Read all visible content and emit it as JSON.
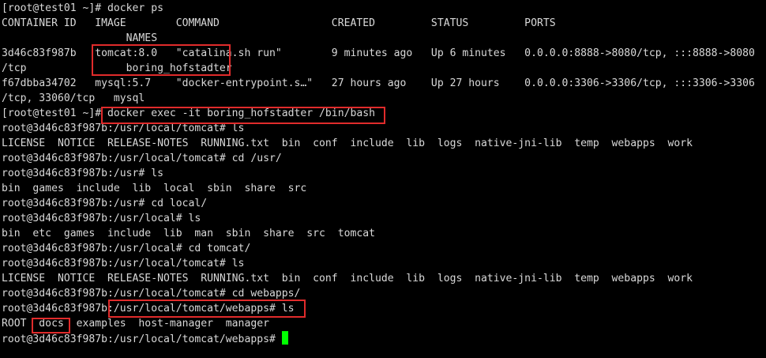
{
  "terminal": {
    "lines": [
      "CONTAINER ID   IMAGE        COMMAND                  CREATED         STATUS         PORTS",
      "                    NAMES",
      "3d46c83f987b   tomcat:8.0   \"catalina.sh run\"        9 minutes ago   Up 6 minutes   0.0.0.0:8888->8080/tcp, :::8888->8080",
      "/tcp                boring_hofstadter",
      "f67dbba34702   mysql:5.7    \"docker-entrypoint.s…\"   27 hours ago    Up 27 hours    0.0.0.0:3306->3306/tcp, :::3306->3306",
      "/tcp, 33060/tcp   mysql",
      "[root@test01 ~]# docker exec -it boring_hofstadter /bin/bash",
      "root@3d46c83f987b:/usr/local/tomcat# ls",
      "LICENSE  NOTICE  RELEASE-NOTES  RUNNING.txt  bin  conf  include  lib  logs  native-jni-lib  temp  webapps  work",
      "root@3d46c83f987b:/usr/local/tomcat# cd /usr/",
      "root@3d46c83f987b:/usr# ls",
      "bin  games  include  lib  local  sbin  share  src",
      "root@3d46c83f987b:/usr# cd local/",
      "root@3d46c83f987b:/usr/local# ls",
      "bin  etc  games  include  lib  man  sbin  share  src  tomcat",
      "root@3d46c83f987b:/usr/local# cd tomcat/",
      "root@3d46c83f987b:/usr/local/tomcat# ls",
      "LICENSE  NOTICE  RELEASE-NOTES  RUNNING.txt  bin  conf  include  lib  logs  native-jni-lib  temp  webapps  work",
      "root@3d46c83f987b:/usr/local/tomcat# cd webapps/",
      "root@3d46c83f987b:/usr/local/tomcat/webapps# ls",
      "ROOT  docs  examples  host-manager  manager",
      "root@3d46c83f987b:/usr/local/tomcat/webapps# "
    ],
    "top_prompt": "[root@test01 ~]# docker ps",
    "cursor_color": "#00ff00",
    "highlight_color": "#e02b2b"
  }
}
